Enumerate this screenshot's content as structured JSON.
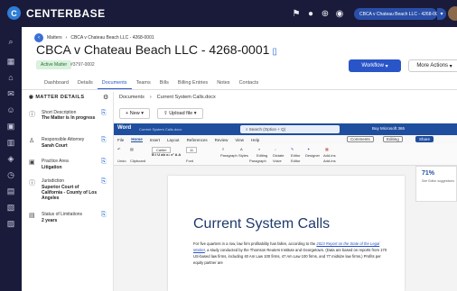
{
  "app": {
    "brand": "CENTERBASE",
    "logo_glyph": "C",
    "context": "CBCA v Chateau Beach LLC - 4268-0001"
  },
  "breadcrumb": {
    "root": "Matters",
    "current": "CBCA v Chateau Beach LLC - 4268-0001"
  },
  "matter": {
    "title": "CBCA v Chateau Beach LLC - 4268-0001",
    "status": "Active Matter",
    "number": "#3797-0002"
  },
  "actions": {
    "workflow": "Workflow",
    "more": "More Actions"
  },
  "tabs": [
    "Dashboard",
    "Details",
    "Documents",
    "Teams",
    "Bills",
    "Billing Entries",
    "Notes",
    "Contacts"
  ],
  "details": {
    "header": "MATTER DETAILS",
    "items": [
      {
        "label": "Short Description",
        "value": "The Matter is In progress"
      },
      {
        "label": "Responsible Attorney",
        "value": "Sarah Court"
      },
      {
        "label": "Practice Area",
        "value": "Litigation"
      },
      {
        "label": "Jurisdiction",
        "value": "Superior Court of California - County of Los Angeles"
      },
      {
        "label": "Status of Limitations",
        "value": "2 years"
      }
    ]
  },
  "documents": {
    "crumb_root": "Documents",
    "crumb_current": "Current System Calls.docx",
    "new_label": "New",
    "upload_label": "Upload file"
  },
  "word": {
    "app": "Word",
    "file": "Current System Calls.docx",
    "search": "Search (Option + Q)",
    "buy": "Buy Microsoft 365",
    "menu": [
      "File",
      "Home",
      "Insert",
      "Layout",
      "References",
      "Review",
      "View",
      "Help"
    ],
    "comments": "Comments",
    "editing": "Editing",
    "share": "Share",
    "ribbon": {
      "font": "Calibri",
      "size": "11",
      "groups": [
        "Undo",
        "Clipboard",
        "Font",
        "Paragraph",
        "Styles",
        "Voice",
        "Editor",
        "Add-ins"
      ],
      "buttons": [
        "Paragraph",
        "Styles",
        "Editing",
        "Dictate",
        "Editor",
        "Designer",
        "Add-ins"
      ]
    },
    "editor_score": "71%",
    "editor_note": "See Editor suggestions"
  },
  "doc": {
    "title": "Current System Calls",
    "p_start": "For five quarters in a row, law firm profitability has fallen, according to the ",
    "p_link": "2023 Report on the State of the Legal Market",
    "p_end": ", a study conducted by the Thomson Reuters Institute and Georgetown. (Data are based on reports from 170 US-based law firms, including 40 Am Law 100 firms, 47 Am Law 100 firms, and 77 midsize law firms.) Profits per equity partner are"
  }
}
